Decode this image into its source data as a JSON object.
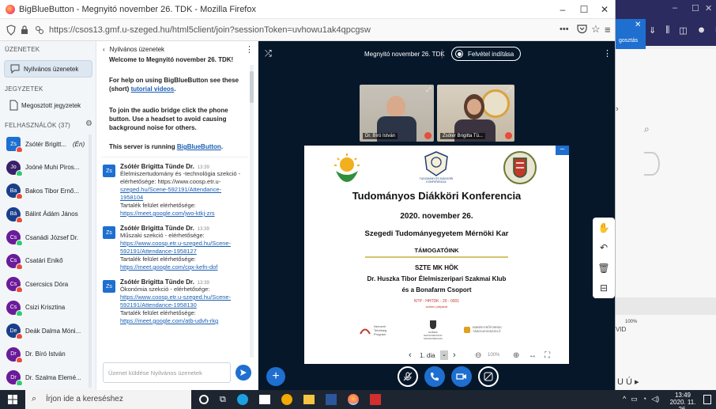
{
  "browser": {
    "title": "BigBlueButton - Megnyitó november 26. TDK - Mozilla Firefox",
    "url": "https://csos13.gmf.u-szeged.hu/html5client/join?sessionToken=uvhowu1ak4qpcgsw",
    "min": "–",
    "max": "☐",
    "close": "✕"
  },
  "left_panel": {
    "messages_header": "ÜZENETEK",
    "public_chat": "Nyilvános üzenetek",
    "notes_header": "JEGYZETEK",
    "shared_notes": "Megosztott jegyzetek",
    "users_header": "FELHASZNÁLÓK (37)",
    "users": [
      {
        "initials": "Zs",
        "name": "Zsótér Brigitt...",
        "suffix": "(Én)",
        "color": "#1e6fd0"
      },
      {
        "initials": "Jo",
        "name": "Joóné Muhi Piros...",
        "color": "#3a1f6b"
      },
      {
        "initials": "Ba",
        "name": "Bakos Tibor Ernő...",
        "color": "#1a3f8a"
      },
      {
        "initials": "Bá",
        "name": "Bálint Ádám János",
        "color": "#1a3f8a"
      },
      {
        "initials": "Cs",
        "name": "Csanádi József Dr.",
        "color": "#6a1b9a"
      },
      {
        "initials": "Cs",
        "name": "Csatári Enikő",
        "color": "#6a1b9a"
      },
      {
        "initials": "Cs",
        "name": "Csercsics Dóra",
        "color": "#6a1b9a"
      },
      {
        "initials": "Cs",
        "name": "Csizi Krisztina",
        "color": "#6a1b9a"
      },
      {
        "initials": "De",
        "name": "Deák Dalma Móni...",
        "color": "#1a3f8a"
      },
      {
        "initials": "Dr",
        "name": "Dr. Bíró István",
        "color": "#6a1b9a"
      },
      {
        "initials": "Dr",
        "name": "Dr. Szalma Elemé...",
        "color": "#6a1b9a"
      }
    ]
  },
  "chat": {
    "back_label": "Nyilvános üzenetek",
    "welcome": "Welcome to Megnyitó november 26. TDK!",
    "help_prefix": "For help on using BigBlueButton see these (short) ",
    "help_link": "tutorial videos",
    "audio": "To join the audio bridge click the phone button. Use a headset to avoid causing background noise for others.",
    "running_prefix": "This server is running ",
    "running_link": "BigBlueButton",
    "messages": [
      {
        "initials": "Zs",
        "name": "Zsótér Brigitta Tünde Dr.",
        "time": "13:39",
        "lines": [
          {
            "t": "Élelmiszertudomány és -technológia szekció -",
            "link": false
          },
          {
            "t": "elérhetősége: https://www.coosp.etr.u-",
            "link": false
          },
          {
            "t": "szeged.hu/Scene-592191/Attendance-",
            "link": true
          },
          {
            "t": "1958104",
            "link": true
          },
          {
            "t": "Tartalék felület elérhetősége:",
            "link": false
          },
          {
            "t": "https://meet.google.com/jwo-ktkj-zrs",
            "link": true
          }
        ]
      },
      {
        "initials": "Zs",
        "name": "Zsótér Brigitta Tünde Dr.",
        "time": "13:39",
        "lines": [
          {
            "t": "Műszaki szekció - elérhetősége:",
            "link": false
          },
          {
            "t": "https://www.coosp.etr.u-szeged.hu/Scene-",
            "link": true
          },
          {
            "t": "592191/Attendance-1958127",
            "link": true
          },
          {
            "t": "Tartalék felület elérhetősége:",
            "link": false
          },
          {
            "t": "https://meet.google.com/cqx-kefn-dof",
            "link": true
          }
        ]
      },
      {
        "initials": "Zs",
        "name": "Zsótér Brigitta Tünde Dr.",
        "time": "13:39",
        "lines": [
          {
            "t": "Ökonómia szekció - elérhetősége:",
            "link": false
          },
          {
            "t": "https://www.coosp.etr.u-szeged.hu/Scene-",
            "link": true
          },
          {
            "t": "592191/Attendance-1958130",
            "link": true
          },
          {
            "t": "Tartalék felület elérhetősége:",
            "link": false
          },
          {
            "t": "https://meet.google.com/atb-udvh-rkg",
            "link": true
          }
        ]
      }
    ],
    "input_placeholder": "Üzenet küldése Nyilvános üzenetek"
  },
  "main": {
    "meeting_title": "Megnyitó november 26. TDK",
    "record_label": "Felvétel indítása",
    "video1_name": "Dr. Bíró István",
    "video2_name": "Zsótér Brigitta Tü...",
    "slide": {
      "title": "Tudományos Diákköri Konferencia",
      "date": "2020. november 26.",
      "faculty": "Szegedi Tudományegyetem Mérnöki Kar",
      "supporters": "TÁMOGATÓINK",
      "s1": "SZTE MK HÖK",
      "s2": "Dr. Huszka Tibor Élelmiszeripari Szakmai Klub",
      "s3": "és a  Bonafarm Csoport",
      "ntp": "NTP - HHTDK - 20 - 0001",
      "ntp_sub": "számú    pályázat",
      "logo_tdk": "TUDOMÁNYOS DIÁKKÖRI KONFERENCIA",
      "logo1": "Nemzeti Tehetség Program",
      "logo2": "EMBERI ERŐFORRÁSOK MINISZTÉRIUMA",
      "logo3": "EMBERI ERŐFORRÁS TÁMOGATÁSKEZELŐ"
    },
    "slide_page": "1. dia",
    "zoom": "100%"
  },
  "bg_window": {
    "label_top": "gosztás",
    "pct": "100%",
    "vid": "VID",
    "letters": "U  Ú ▸"
  },
  "taskbar": {
    "search_placeholder": "Írjon ide a kereséshez",
    "time": "13:49",
    "date": "2020. 11. 26."
  },
  "colors": {
    "bbb_dark": "#06172a",
    "bbb_blue": "#1e6fd0",
    "record_red": "#e74c3c"
  }
}
